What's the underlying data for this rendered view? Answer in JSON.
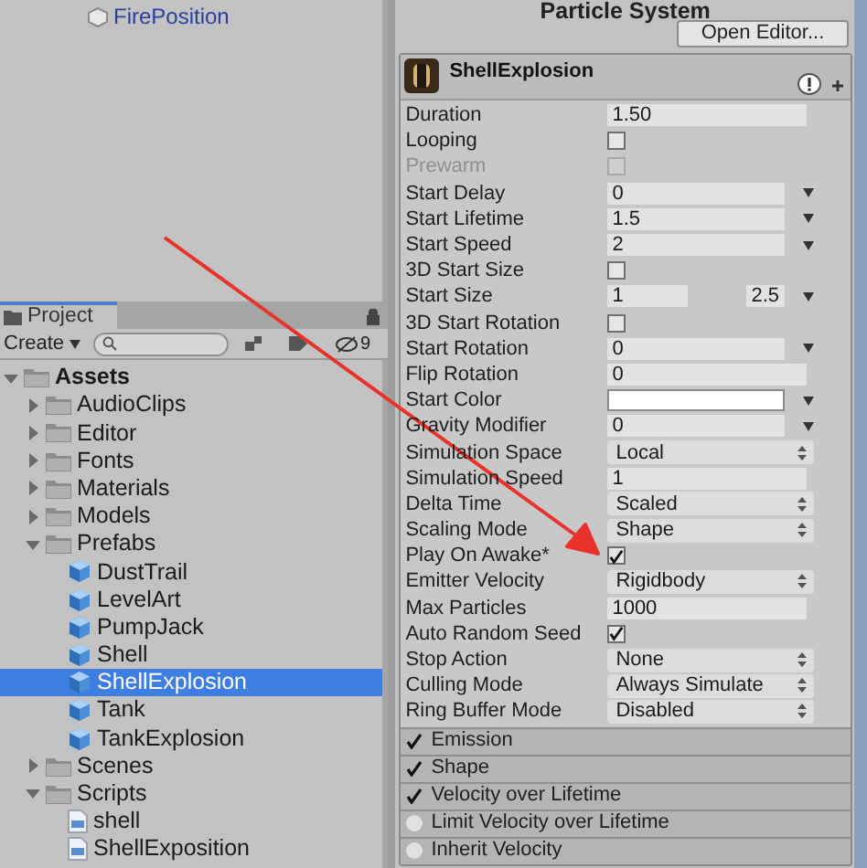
{
  "hierarchy": {
    "items": [
      {
        "label": "FirePosition"
      }
    ]
  },
  "project": {
    "tab": "Project",
    "create": "Create",
    "filter_count": "9",
    "tree": [
      {
        "label": "Assets",
        "kind": "folder",
        "expanded": true,
        "selected": false,
        "children": [
          {
            "label": "AudioClips",
            "kind": "folder",
            "expanded": false,
            "selected": false
          },
          {
            "label": "Editor",
            "kind": "folder",
            "expanded": false,
            "selected": false
          },
          {
            "label": "Fonts",
            "kind": "folder",
            "expanded": false,
            "selected": false
          },
          {
            "label": "Materials",
            "kind": "folder",
            "expanded": false,
            "selected": false
          },
          {
            "label": "Models",
            "kind": "folder",
            "expanded": false,
            "selected": false
          },
          {
            "label": "Prefabs",
            "kind": "folder",
            "expanded": true,
            "selected": false,
            "children": [
              {
                "label": "DustTrail",
                "kind": "prefab",
                "selected": false
              },
              {
                "label": "LevelArt",
                "kind": "prefab",
                "selected": false
              },
              {
                "label": "PumpJack",
                "kind": "prefab",
                "selected": false
              },
              {
                "label": "Shell",
                "kind": "prefab",
                "selected": false
              },
              {
                "label": "ShellExplosion",
                "kind": "prefab",
                "selected": true
              },
              {
                "label": "Tank",
                "kind": "prefab",
                "selected": false
              },
              {
                "label": "TankExplosion",
                "kind": "prefab",
                "selected": false
              }
            ]
          },
          {
            "label": "Scenes",
            "kind": "folder",
            "expanded": false,
            "selected": false
          },
          {
            "label": "Scripts",
            "kind": "folder",
            "expanded": true,
            "selected": false,
            "children": [
              {
                "label": "shell",
                "kind": "script",
                "selected": false
              },
              {
                "label": "ShellExposition",
                "kind": "script",
                "selected": false
              }
            ]
          }
        ]
      }
    ]
  },
  "inspector": {
    "title": "Particle System",
    "open_editor": "Open Editor...",
    "component": {
      "name": "ShellExplosion"
    },
    "properties": [
      {
        "label": "Duration",
        "kind": "float",
        "value": "1.50",
        "disabled": false
      },
      {
        "label": "Looping",
        "kind": "checkbox",
        "checked": false,
        "disabled": false
      },
      {
        "label": "Prewarm",
        "kind": "checkbox",
        "checked": false,
        "disabled": true
      },
      {
        "label": "Start Delay",
        "kind": "curve",
        "value": "0",
        "disabled": false
      },
      {
        "label": "Start Lifetime",
        "kind": "curve",
        "value": "1.5",
        "disabled": false
      },
      {
        "label": "Start Speed",
        "kind": "curve",
        "value": "2",
        "disabled": false
      },
      {
        "label": "3D Start Size",
        "kind": "checkbox",
        "checked": false,
        "disabled": false
      },
      {
        "label": "Start Size",
        "kind": "range",
        "value": "1",
        "value_2": "2.5",
        "disabled": false
      },
      {
        "label": "3D Start Rotation",
        "kind": "checkbox",
        "checked": false,
        "disabled": false
      },
      {
        "label": "Start Rotation",
        "kind": "curve",
        "value": "0",
        "disabled": false
      },
      {
        "label": "Flip Rotation",
        "kind": "float",
        "value": "0",
        "disabled": false
      },
      {
        "label": "Start Color",
        "kind": "color",
        "color": "#ffffff",
        "disabled": false
      },
      {
        "label": "Gravity Modifier",
        "kind": "curve",
        "value": "0",
        "disabled": false
      },
      {
        "label": "Simulation Space",
        "kind": "popup",
        "value": "Local",
        "disabled": false
      },
      {
        "label": "Simulation Speed",
        "kind": "float",
        "value": "1",
        "disabled": false
      },
      {
        "label": "Delta Time",
        "kind": "popup",
        "value": "Scaled",
        "disabled": false
      },
      {
        "label": "Scaling Mode",
        "kind": "popup",
        "value": "Shape",
        "disabled": false
      },
      {
        "label": "Play On Awake*",
        "kind": "checkbox",
        "checked": true,
        "disabled": false
      },
      {
        "label": "Emitter Velocity",
        "kind": "popup",
        "value": "Rigidbody",
        "disabled": false
      },
      {
        "label": "Max Particles",
        "kind": "float",
        "value": "1000",
        "disabled": false
      },
      {
        "label": "Auto Random Seed",
        "kind": "checkbox",
        "checked": true,
        "disabled": false
      },
      {
        "label": "Stop Action",
        "kind": "popup",
        "value": "None",
        "disabled": false
      },
      {
        "label": "Culling Mode",
        "kind": "popup",
        "value": "Always Simulate",
        "disabled": false
      },
      {
        "label": "Ring Buffer Mode",
        "kind": "popup",
        "value": "Disabled",
        "disabled": false
      }
    ],
    "modules": [
      {
        "label": "Emission",
        "enabled": true
      },
      {
        "label": "Shape",
        "enabled": true
      },
      {
        "label": "Velocity over Lifetime",
        "enabled": true
      },
      {
        "label": "Limit Velocity over Lifetime",
        "enabled": false
      },
      {
        "label": "Inherit Velocity",
        "enabled": false
      }
    ]
  }
}
